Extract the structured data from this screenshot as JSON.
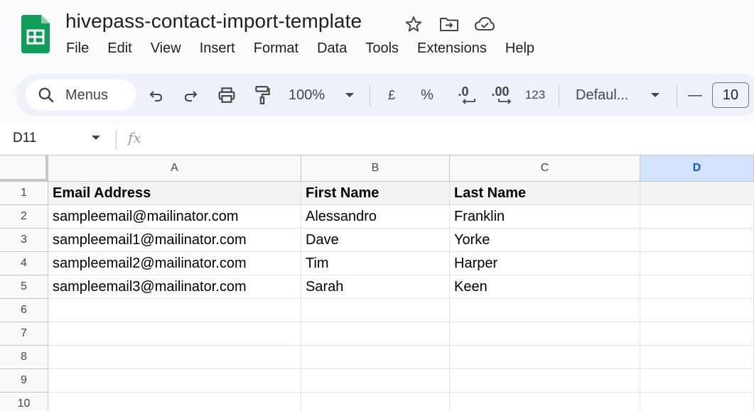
{
  "app": {
    "doc_title": "hivepass-contact-import-template",
    "brand_color": "#0f9d58",
    "title_icons": [
      "star-icon",
      "move-to-folder-icon",
      "cloud-saved-icon"
    ]
  },
  "menu": [
    "File",
    "Edit",
    "View",
    "Insert",
    "Format",
    "Data",
    "Tools",
    "Extensions",
    "Help"
  ],
  "toolbar": {
    "search_label": "Menus",
    "zoom": "100%",
    "currency": "£",
    "percent": "%",
    "decrease_decimal": ".0",
    "increase_decimal": ".00",
    "number_format": "123",
    "font": "Defaul...",
    "minus": "—",
    "font_size": "10"
  },
  "formula_bar": {
    "cell_ref": "D11",
    "fx": "fx",
    "value": ""
  },
  "grid": {
    "columns": [
      "A",
      "B",
      "C",
      "D"
    ],
    "selected_column": "D",
    "row_numbers": [
      "1",
      "2",
      "3",
      "4",
      "5",
      "6",
      "7",
      "8",
      "9",
      "10"
    ],
    "rows": [
      [
        "Email Address",
        "First Name",
        "Last Name",
        ""
      ],
      [
        "sampleemail@mailinator.com",
        "Alessandro",
        "Franklin",
        ""
      ],
      [
        "sampleemail1@mailinator.com",
        "Dave",
        "Yorke",
        ""
      ],
      [
        "sampleemail2@mailinator.com",
        "Tim",
        "Harper",
        ""
      ],
      [
        "sampleemail3@mailinator.com",
        "Sarah",
        "Keen",
        ""
      ],
      [
        "",
        "",
        "",
        ""
      ],
      [
        "",
        "",
        "",
        ""
      ],
      [
        "",
        "",
        "",
        ""
      ],
      [
        "",
        "",
        "",
        ""
      ],
      [
        "",
        "",
        "",
        ""
      ]
    ]
  }
}
